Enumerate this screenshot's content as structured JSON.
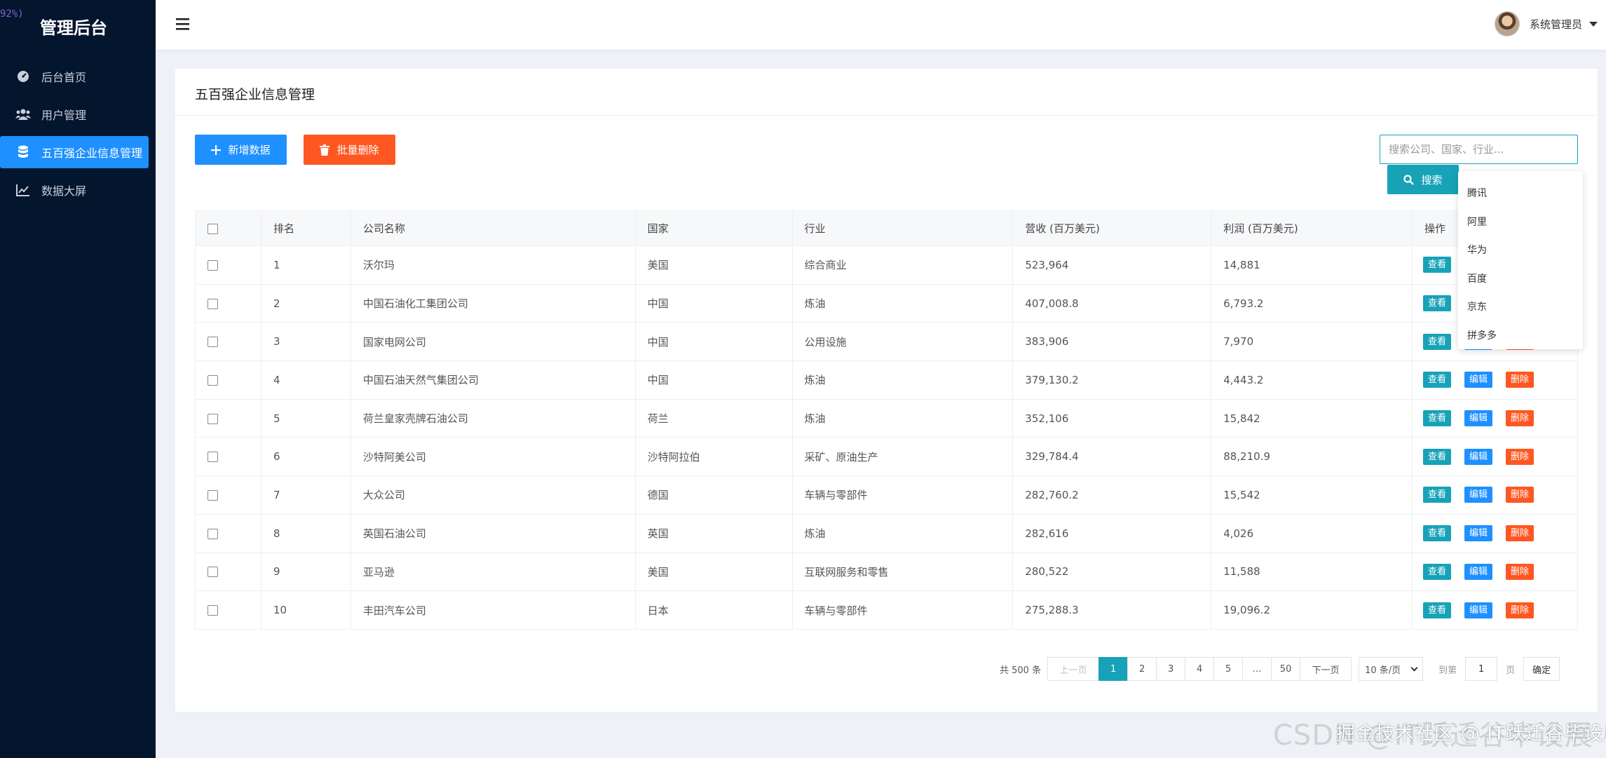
{
  "zoom_tag": "92%)",
  "sidebar": {
    "brand": "管理后台",
    "items": [
      {
        "label": "后台首页",
        "icon": "dashboard-icon",
        "active": false
      },
      {
        "label": "用户管理",
        "icon": "users-icon",
        "active": false
      },
      {
        "label": "五百强企业信息管理",
        "icon": "database-icon",
        "active": true
      },
      {
        "label": "数据大屏",
        "icon": "line-chart-icon",
        "active": false
      }
    ]
  },
  "header": {
    "user_name": "系统管理员"
  },
  "main": {
    "title": "五百强企业信息管理",
    "add_label": "新增数据",
    "batch_delete_label": "批量删除",
    "search_placeholder": "搜索公司、国家、行业...",
    "search_label": "搜索",
    "suggestions": [
      "腾讯",
      "阿里",
      "华为",
      "百度",
      "京东",
      "拼多多"
    ],
    "columns": [
      "排名",
      "公司名称",
      "国家",
      "行业",
      "营收 (百万美元)",
      "利润 (百万美元)",
      "操作"
    ],
    "actions": {
      "view": "查看",
      "edit": "编辑",
      "delete": "删除"
    },
    "rows": [
      {
        "rank": "1",
        "company": "沃尔玛",
        "country": "美国",
        "industry": "综合商业",
        "revenue": "523,964",
        "profit": "14,881"
      },
      {
        "rank": "2",
        "company": "中国石油化工集团公司",
        "country": "中国",
        "industry": "炼油",
        "revenue": "407,008.8",
        "profit": "6,793.2"
      },
      {
        "rank": "3",
        "company": "国家电网公司",
        "country": "中国",
        "industry": "公用设施",
        "revenue": "383,906",
        "profit": "7,970"
      },
      {
        "rank": "4",
        "company": "中国石油天然气集团公司",
        "country": "中国",
        "industry": "炼油",
        "revenue": "379,130.2",
        "profit": "4,443.2"
      },
      {
        "rank": "5",
        "company": "荷兰皇家壳牌石油公司",
        "country": "荷兰",
        "industry": "炼油",
        "revenue": "352,106",
        "profit": "15,842"
      },
      {
        "rank": "6",
        "company": "沙特阿美公司",
        "country": "沙特阿拉伯",
        "industry": "采矿、原油生产",
        "revenue": "329,784.4",
        "profit": "88,210.9"
      },
      {
        "rank": "7",
        "company": "大众公司",
        "country": "德国",
        "industry": "车辆与零部件",
        "revenue": "282,760.2",
        "profit": "15,542"
      },
      {
        "rank": "8",
        "company": "英国石油公司",
        "country": "英国",
        "industry": "炼油",
        "revenue": "282,616",
        "profit": "4,026"
      },
      {
        "rank": "9",
        "company": "亚马逊",
        "country": "美国",
        "industry": "互联网服务和零售",
        "revenue": "280,522",
        "profit": "11,588"
      },
      {
        "rank": "10",
        "company": "丰田汽车公司",
        "country": "日本",
        "industry": "车辆与零部件",
        "revenue": "275,288.3",
        "profit": "19,096.2"
      }
    ]
  },
  "pagination": {
    "total": "共 500 条",
    "prev": "上一页",
    "pages": [
      "1",
      "2",
      "3",
      "4",
      "5",
      "...",
      "50"
    ],
    "current": "1",
    "next": "下一页",
    "page_size": "10 条/页",
    "goto_prefix": "到第",
    "goto_value": "1",
    "goto_suffix": "页",
    "confirm": "确定"
  },
  "watermark": {
    "back": "CSDN @IT跃迁谷毕设展",
    "front": "掘金技术社区 @ IT跃迁谷毕设展"
  }
}
